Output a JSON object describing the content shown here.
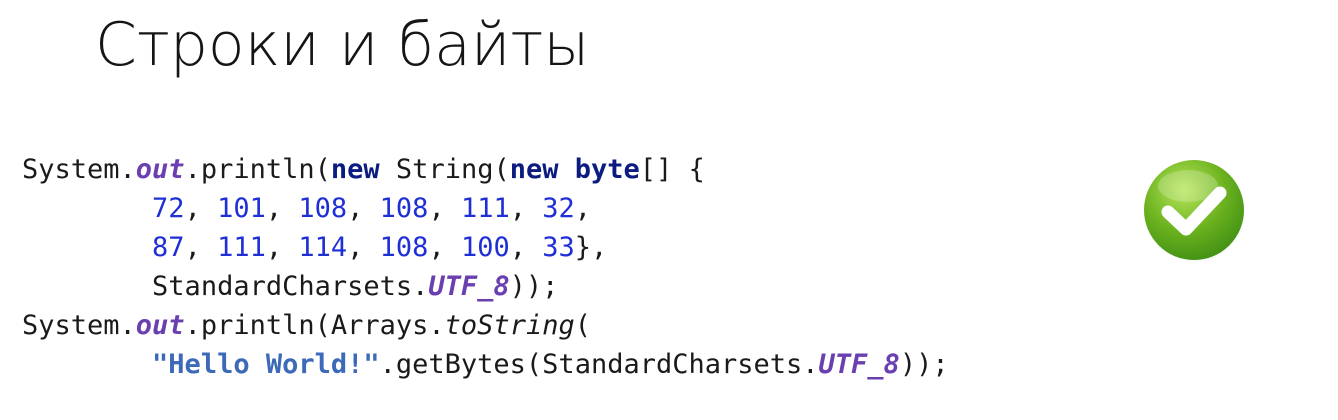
{
  "slide": {
    "title": "Строки и байты"
  },
  "code": {
    "line1": {
      "a": "System.",
      "b": "out",
      "c": ".println(",
      "d": "new",
      "e": " String(",
      "f": "new",
      "g": " ",
      "h": "byte",
      "i": "[] {"
    },
    "line2": {
      "indent": "        ",
      "n1": "72",
      "s1": ", ",
      "n2": "101",
      "s2": ", ",
      "n3": "108",
      "s3": ", ",
      "n4": "108",
      "s4": ", ",
      "n5": "111",
      "s5": ", ",
      "n6": "32",
      "s6": ","
    },
    "line3": {
      "indent": "        ",
      "n1": "87",
      "s1": ", ",
      "n2": "111",
      "s2": ", ",
      "n3": "114",
      "s3": ", ",
      "n4": "108",
      "s4": ", ",
      "n5": "100",
      "s5": ", ",
      "n6": "33",
      "s6": "},"
    },
    "line4": {
      "indent": "        ",
      "a": "StandardCharsets.",
      "b": "UTF_8",
      "c": "));"
    },
    "line5": {
      "a": "System.",
      "b": "out",
      "c": ".println(Arrays.",
      "d": "toString",
      "e": "("
    },
    "line6": {
      "indent": "        ",
      "a": "\"Hello World!\"",
      "b": ".getBytes(StandardCharsets.",
      "c": "UTF_8",
      "d": "));"
    }
  },
  "icons": {
    "check": "checkmark-icon",
    "check_color_light": "#9bd94a",
    "check_color_dark": "#3f8f14"
  }
}
